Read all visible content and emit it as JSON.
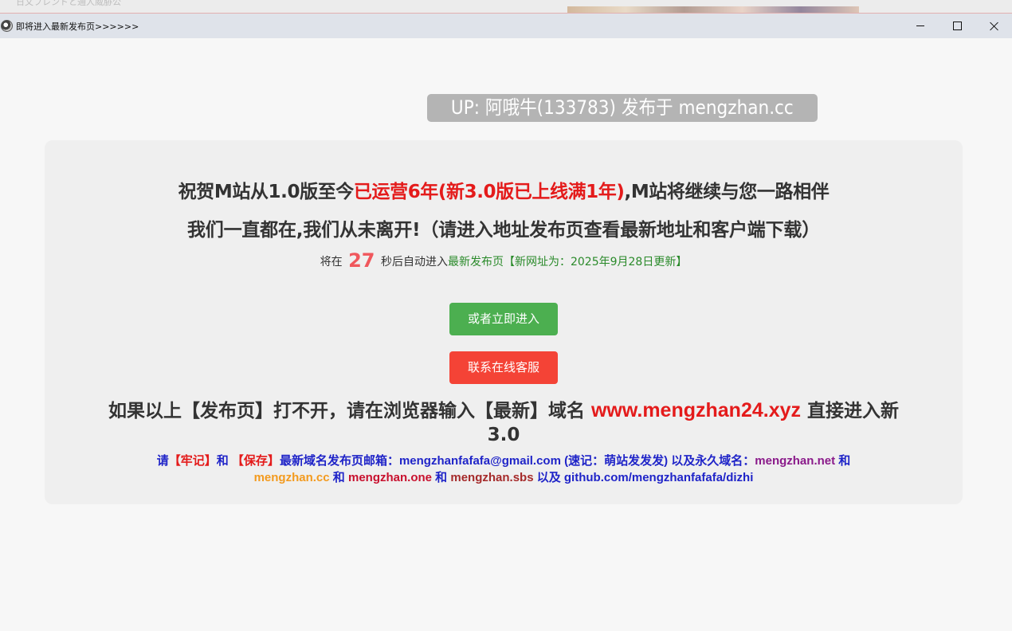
{
  "window": {
    "behind_title": "日文フレンドと通人威胁公",
    "title": "即将进入最新发布页>>>>>>"
  },
  "badge": {
    "text": "UP: 阿哦牛(133783) 发布于 mengzhan.cc"
  },
  "headline1": {
    "part1": "祝贺M站从1.0版至今",
    "part2_red": "已运营6年(新3.0版已上线满1年)",
    "part3": ",M站将继续与您一路相伴"
  },
  "headline2": "我们一直都在,我们从未离开!（请进入地址发布页查看最新地址和客户端下载）",
  "countdown": {
    "prefix": "将在",
    "seconds": "27",
    "suffix": "秒后自动进入",
    "link_text": "最新发布页【新网址为：2025年9月28日更新】"
  },
  "buttons": {
    "enter": "或者立即进入",
    "service": "联系在线客服"
  },
  "domain_line": {
    "prefix": "如果以上【发布页】打不开，请在浏览器输入【最新】域名",
    "domain": "www.mengzhan24.xyz",
    "suffix": "直接进入新3.0"
  },
  "footer": {
    "t1": "请",
    "t2_red": "【牢记】",
    "t3": "和",
    "t4_red": "【保存】",
    "t5": "最新域名发布页邮箱：mengzhanfafafa@gmail.com (速记：萌站发发发) 以及永久域名：",
    "d1_purple": "mengzhan.net",
    "t6": "和",
    "d2_orange": "mengzhan.cc",
    "t7": "和",
    "d3_crimson": "mengzhan.one",
    "t8": "和",
    "d4_brown": "mengzhan.sbs",
    "t9": "以及 github.com/mengzhanfafafa/dizhi"
  },
  "colors": {
    "page_bg": "#f7f7f7",
    "card_bg": "#efefef",
    "red": "#e41b1b",
    "green_button": "#4caf50",
    "red_button": "#f44336",
    "footer_blue": "#1f24c8"
  }
}
